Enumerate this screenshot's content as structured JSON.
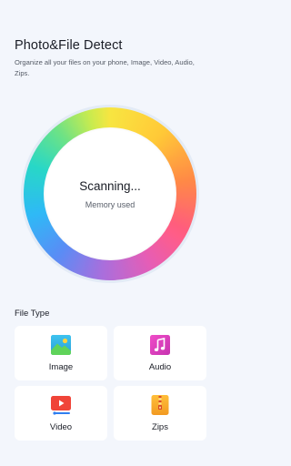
{
  "header": {
    "title": "Photo&File Detect",
    "subtitle": "Organize all your files on your phone, Image, Video, Audio, Zips."
  },
  "scanner": {
    "status": "Scanning...",
    "caption": "Memory used"
  },
  "file_types": {
    "label": "File Type",
    "items": [
      {
        "label": "Image",
        "icon": "image-icon",
        "color": "#2fb8e0"
      },
      {
        "label": "Audio",
        "icon": "music-note-icon",
        "color": "#e03fbd"
      },
      {
        "label": "Video",
        "icon": "play-video-icon",
        "color": "#f04438"
      },
      {
        "label": "Zips",
        "icon": "zip-archive-icon",
        "color": "#f2a22a"
      }
    ]
  },
  "colors": {
    "background": "#f3f6fc",
    "card": "#ffffff"
  }
}
